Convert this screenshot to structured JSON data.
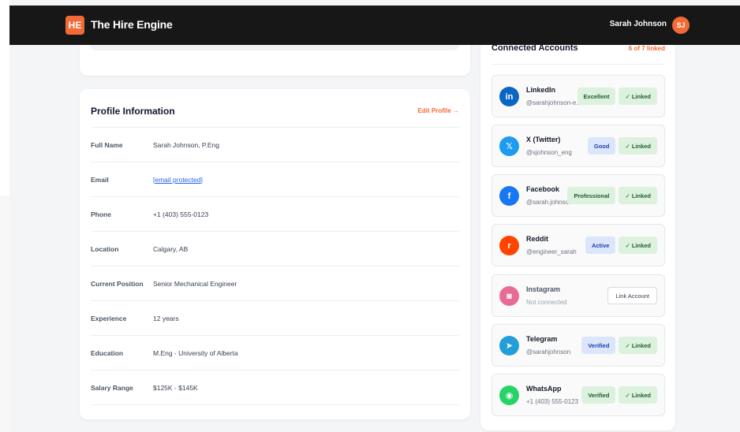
{
  "app": {
    "logo_text": "HE",
    "name": "The Hire Engine"
  },
  "user": {
    "name": "Sarah Johnson",
    "initials": "SJ"
  },
  "profile": {
    "title": "Profile Information",
    "edit_label": "Edit Profile →",
    "fields": [
      {
        "label": "Full Name",
        "value": "Sarah Johnson, P.Eng"
      },
      {
        "label": "Email",
        "value": "[email protected]"
      },
      {
        "label": "Phone",
        "value": "+1 (403) 555-0123"
      },
      {
        "label": "Location",
        "value": "Calgary, AB"
      },
      {
        "label": "Current Position",
        "value": "Senior Mechanical Engineer"
      },
      {
        "label": "Experience",
        "value": "12 years"
      },
      {
        "label": "Education",
        "value": "M.Eng - University of Alberta"
      },
      {
        "label": "Salary Range",
        "value": "$125K - $145K"
      }
    ]
  },
  "accounts": {
    "title": "Connected Accounts",
    "count_label": "6 of 7 linked",
    "items": [
      {
        "name": "LinkedIn",
        "handle": "@sarahjohnson-e...",
        "icon_glyph": "in",
        "icon": "linkedin-icon",
        "color": "#0a66c2",
        "badge": "Excellent",
        "badge_style": "green",
        "linked_label": "✓ Linked"
      },
      {
        "name": "X (Twitter)",
        "handle": "@sjohnson_eng",
        "icon_glyph": "𝕏",
        "icon": "x-twitter-icon",
        "color": "#1d9bf0",
        "badge": "Good",
        "badge_style": "blue",
        "linked_label": "✓ Linked"
      },
      {
        "name": "Facebook",
        "handle": "@sarah.johnson",
        "icon_glyph": "f",
        "icon": "facebook-icon",
        "color": "#1877f2",
        "badge": "Professional",
        "badge_style": "green",
        "linked_label": "✓ Linked"
      },
      {
        "name": "Reddit",
        "handle": "@engineer_sarah",
        "icon_glyph": "r",
        "icon": "reddit-icon",
        "color": "#ff4500",
        "badge": "Active",
        "badge_style": "blue",
        "linked_label": "✓ Linked"
      },
      {
        "name": "Instagram",
        "handle": "Not connected",
        "icon_glyph": "◙",
        "icon": "instagram-icon",
        "color": "#e1306c",
        "action_label": "Link Account"
      },
      {
        "name": "Telegram",
        "handle": "@sarahjohnson",
        "icon_glyph": "➤",
        "icon": "telegram-icon",
        "color": "#229ed9",
        "badge": "Verified",
        "badge_style": "blue",
        "linked_label": "✓ Linked"
      },
      {
        "name": "WhatsApp",
        "handle": "+1 (403) 555-0123",
        "icon_glyph": "◉",
        "icon": "whatsapp-icon",
        "color": "#25d366",
        "badge": "Verified",
        "badge_style": "green",
        "linked_label": "✓ Linked"
      }
    ]
  }
}
